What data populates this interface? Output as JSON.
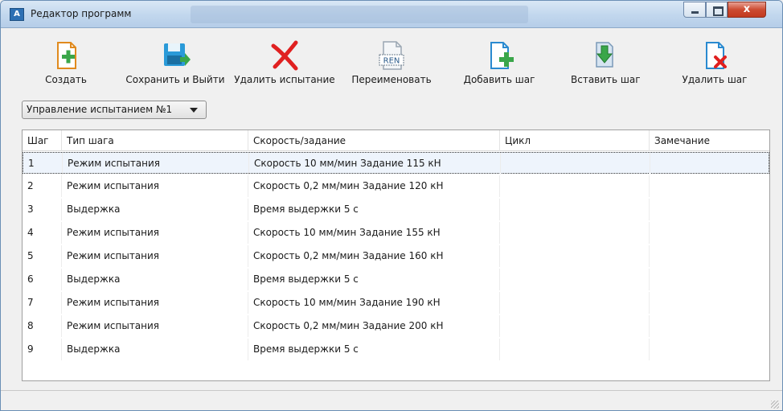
{
  "window": {
    "title": "Редактор программ",
    "close_label": "x",
    "app_icon": "A"
  },
  "toolbar": {
    "create": "Создать",
    "save_exit": "Сохранить и Выйти",
    "delete_test": "Удалить испытание",
    "rename": "Переименовать",
    "rename_icon_text": "REN",
    "add_step": "Добавить шаг",
    "insert_step": "Вставить шаг",
    "delete_step": "Удалить шаг"
  },
  "selector": {
    "value": "Управление испытанием №1"
  },
  "table": {
    "headers": {
      "step": "Шаг",
      "type": "Тип шага",
      "speed": "Скорость/задание",
      "cycle": "Цикл",
      "note": "Замечание"
    },
    "rows": [
      {
        "step": "1",
        "type": "Режим испытания",
        "speed": "Скорость 10 мм/мин Задание 115 кН",
        "cycle": "",
        "note": ""
      },
      {
        "step": "2",
        "type": "Режим испытания",
        "speed": "Скорость 0,2 мм/мин Задание 120 кН",
        "cycle": "",
        "note": ""
      },
      {
        "step": "3",
        "type": "Выдержка",
        "speed": " Время выдержки 5 с",
        "cycle": "",
        "note": ""
      },
      {
        "step": "4",
        "type": "Режим испытания",
        "speed": "Скорость 10 мм/мин Задание 155 кН",
        "cycle": "",
        "note": ""
      },
      {
        "step": "5",
        "type": "Режим испытания",
        "speed": "Скорость 0,2 мм/мин Задание 160 кН",
        "cycle": "",
        "note": ""
      },
      {
        "step": "6",
        "type": "Выдержка",
        "speed": " Время выдержки 5 с",
        "cycle": "",
        "note": ""
      },
      {
        "step": "7",
        "type": "Режим испытания",
        "speed": "Скорость 10 мм/мин Задание 190 кН",
        "cycle": "",
        "note": ""
      },
      {
        "step": "8",
        "type": "Режим испытания",
        "speed": "Скорость 0,2 мм/мин Задание 200 кН",
        "cycle": "",
        "note": ""
      },
      {
        "step": "9",
        "type": "Выдержка",
        "speed": " Время выдержки 5 с",
        "cycle": "",
        "note": ""
      }
    ]
  },
  "colors": {
    "accent_green": "#3aa64a",
    "accent_orange": "#f0a020",
    "delete_red": "#e02020",
    "selection": "#eef4fc"
  },
  "icons": {
    "create": "new-document-icon",
    "save_exit": "save-exit-icon",
    "delete_test": "delete-x-icon",
    "rename": "rename-icon",
    "add_step": "add-step-icon",
    "insert_step": "insert-step-icon",
    "delete_step": "delete-step-icon"
  }
}
